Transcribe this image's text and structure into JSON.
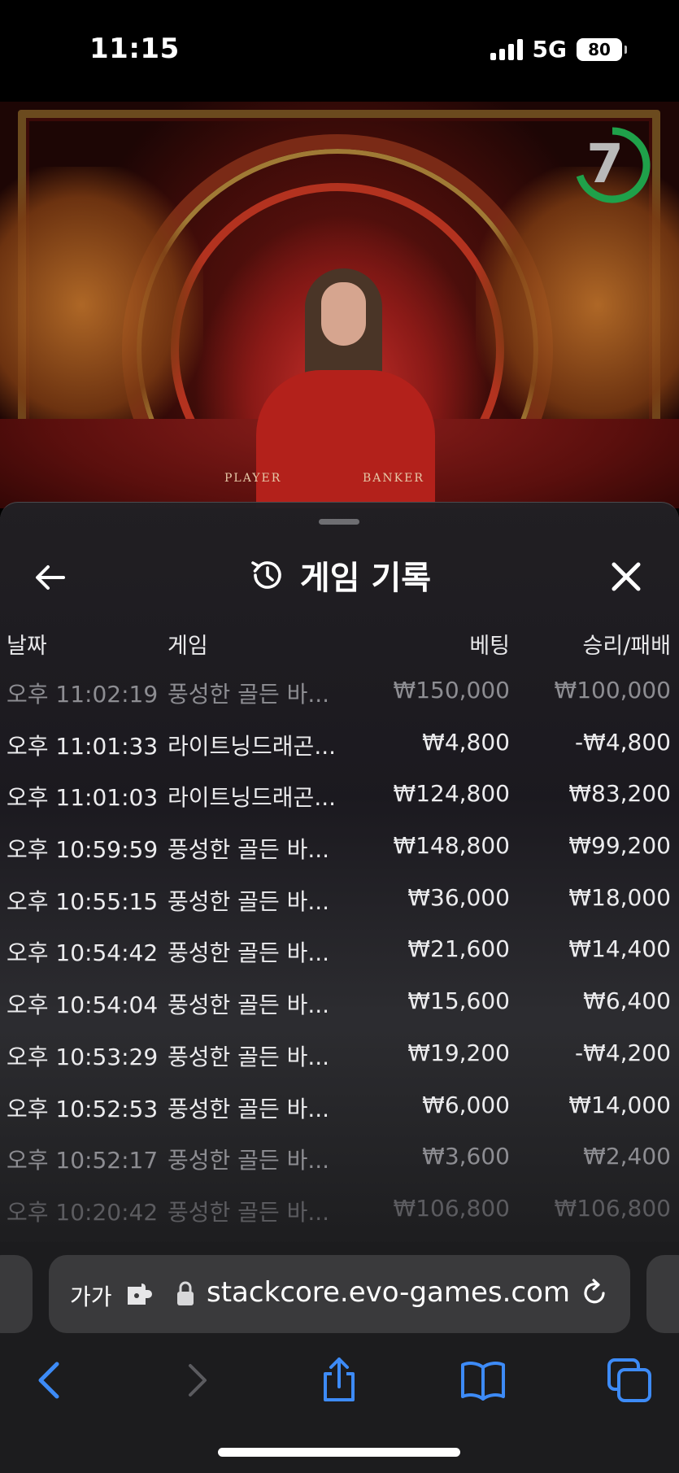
{
  "status_bar": {
    "time": "11:15",
    "network": "5G",
    "battery": "80"
  },
  "video": {
    "timer": "7",
    "table_player": "PLAYER",
    "table_banker": "BANKER",
    "timer_progress": 0.7,
    "timer_color": "#1fa14a"
  },
  "panel": {
    "title": "게임 기록",
    "columns": {
      "date": "날짜",
      "game": "게임",
      "bet": "베팅",
      "winloss": "승리/패배"
    },
    "rows": [
      {
        "time": "오후 11:02:19",
        "game": "풍성한 골든 바...",
        "bet": "₩150,000",
        "result": "₩100,000"
      },
      {
        "time": "오후 11:01:33",
        "game": "라이트닝드래곤...",
        "bet": "₩4,800",
        "result": "-₩4,800"
      },
      {
        "time": "오후 11:01:03",
        "game": "라이트닝드래곤...",
        "bet": "₩124,800",
        "result": "₩83,200"
      },
      {
        "time": "오후 10:59:59",
        "game": "풍성한 골든 바...",
        "bet": "₩148,800",
        "result": "₩99,200"
      },
      {
        "time": "오후 10:55:15",
        "game": "풍성한 골든 바...",
        "bet": "₩36,000",
        "result": "₩18,000"
      },
      {
        "time": "오후 10:54:42",
        "game": "풍성한 골든 바...",
        "bet": "₩21,600",
        "result": "₩14,400"
      },
      {
        "time": "오후 10:54:04",
        "game": "풍성한 골든 바...",
        "bet": "₩15,600",
        "result": "₩6,400"
      },
      {
        "time": "오후 10:53:29",
        "game": "풍성한 골든 바...",
        "bet": "₩19,200",
        "result": "-₩4,200"
      },
      {
        "time": "오후 10:52:53",
        "game": "풍성한 골든 바...",
        "bet": "₩6,000",
        "result": "₩14,000"
      },
      {
        "time": "오후 10:52:17",
        "game": "풍성한 골든 바...",
        "bet": "₩3,600",
        "result": "₩2,400"
      },
      {
        "time": "오후 10:20:42",
        "game": "풍성한 골든 바...",
        "bet": "₩106,800",
        "result": "₩106,800"
      }
    ]
  },
  "browser": {
    "text_size_label": "가가",
    "url": "stackcore.evo-games.com",
    "accent_color": "#3d8bf7"
  }
}
